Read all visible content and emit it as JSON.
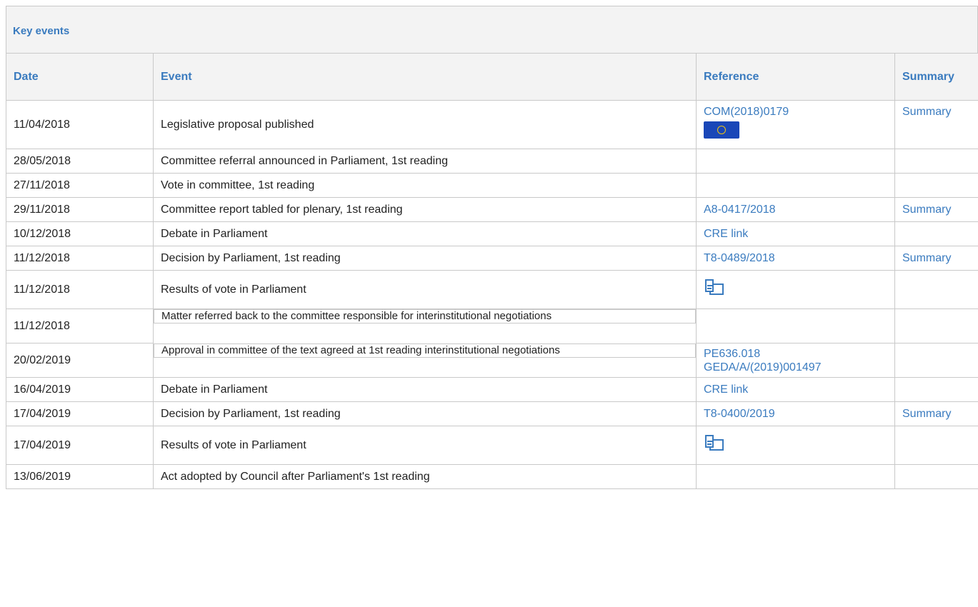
{
  "panel": {
    "title": "Key events"
  },
  "columns": {
    "date": "Date",
    "event": "Event",
    "reference": "Reference",
    "summary": "Summary"
  },
  "rows": [
    {
      "date": "11/04/2018",
      "event": "Legislative proposal published",
      "refs": [
        "COM(2018)0179"
      ],
      "icon": "eu-flag-icon",
      "summary": "Summary"
    },
    {
      "date": "28/05/2018",
      "event": "Committee referral announced in Parliament, 1st reading",
      "refs": [],
      "summary": ""
    },
    {
      "date": "27/11/2018",
      "event": "Vote in committee, 1st reading",
      "refs": [],
      "summary": ""
    },
    {
      "date": "29/11/2018",
      "event": "Committee report tabled for plenary, 1st reading",
      "refs": [
        "A8-0417/2018"
      ],
      "summary": "Summary"
    },
    {
      "date": "10/12/2018",
      "event": "Debate in Parliament",
      "refs": [
        "CRE link"
      ],
      "summary": ""
    },
    {
      "date": "11/12/2018",
      "event": "Decision by Parliament, 1st reading",
      "refs": [
        "T8-0489/2018"
      ],
      "summary": "Summary"
    },
    {
      "date": "11/12/2018",
      "event": "Results of vote in Parliament",
      "refs": [],
      "icon": "vote-results-icon",
      "summary": ""
    },
    {
      "date": "11/12/2018",
      "event": "Matter referred back to the committee responsible for interinstitutional negotiations",
      "refs": [],
      "summary": ""
    },
    {
      "date": "20/02/2019",
      "event": "Approval in committee of the text agreed at 1st reading interinstitutional negotiations",
      "refs": [
        "PE636.018",
        "GEDA/A/(2019)001497"
      ],
      "summary": ""
    },
    {
      "date": "16/04/2019",
      "event": "Debate in Parliament",
      "refs": [
        "CRE link"
      ],
      "summary": ""
    },
    {
      "date": "17/04/2019",
      "event": "Decision by Parliament, 1st reading",
      "refs": [
        "T8-0400/2019"
      ],
      "summary": "Summary"
    },
    {
      "date": "17/04/2019",
      "event": "Results of vote in Parliament",
      "refs": [],
      "icon": "vote-results-icon",
      "summary": ""
    },
    {
      "date": "13/06/2019",
      "event": "Act adopted by Council after Parliament's 1st reading",
      "refs": [],
      "summary": ""
    }
  ],
  "colors": {
    "link": "#3a7bbf",
    "header_bg": "#f3f3f3",
    "border": "#c9c9c9"
  }
}
